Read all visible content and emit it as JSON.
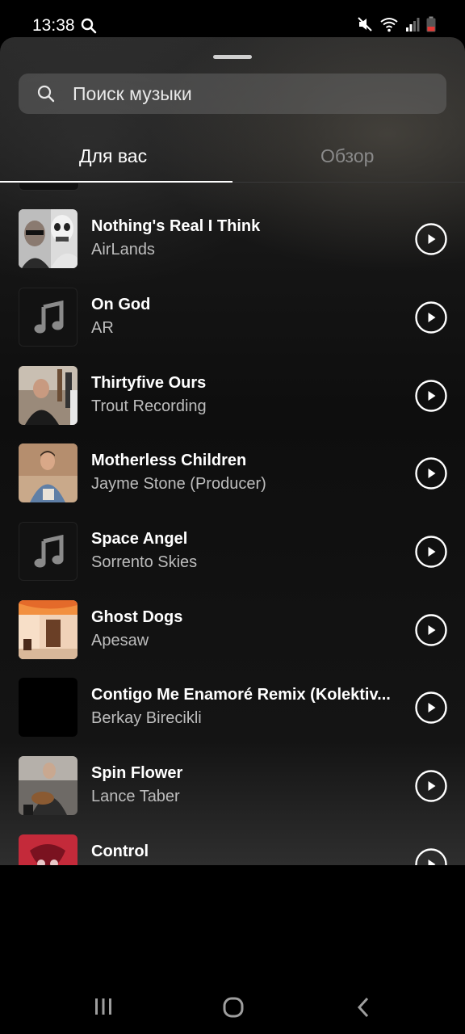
{
  "status_bar": {
    "time": "13:38"
  },
  "search": {
    "placeholder": "Поиск музыки"
  },
  "tabs": [
    {
      "label": "Для вас",
      "active": true
    },
    {
      "label": "Обзор",
      "active": false
    }
  ],
  "tracks": [
    {
      "title": "Nothing's Real I Think",
      "artist": "AirLands",
      "art": "photo-skull"
    },
    {
      "title": "On God",
      "artist": "AR",
      "art": "music-note-placeholder"
    },
    {
      "title": "Thirtyfive Ours",
      "artist": "Trout Recording",
      "art": "photo-studio"
    },
    {
      "title": "Motherless Children",
      "artist": "Jayme Stone (Producer)",
      "art": "photo-portrait"
    },
    {
      "title": "Space Angel",
      "artist": "Sorrento Skies",
      "art": "music-note-placeholder"
    },
    {
      "title": "Ghost Dogs",
      "artist": "Apesaw",
      "art": "photo-room-orange"
    },
    {
      "title": "Contigo Me Enamoré Remix (Kolektiv...",
      "artist": "Berkay Birecikli",
      "art": "black"
    },
    {
      "title": "Spin Flower",
      "artist": "Lance Taber",
      "art": "photo-guitarist"
    },
    {
      "title": "Control",
      "artist": "",
      "art": "illustration-red"
    }
  ],
  "colors": {
    "text_primary": "#ffffff",
    "text_secondary": "#bdbdbd",
    "tab_inactive": "#8a8a8a"
  }
}
